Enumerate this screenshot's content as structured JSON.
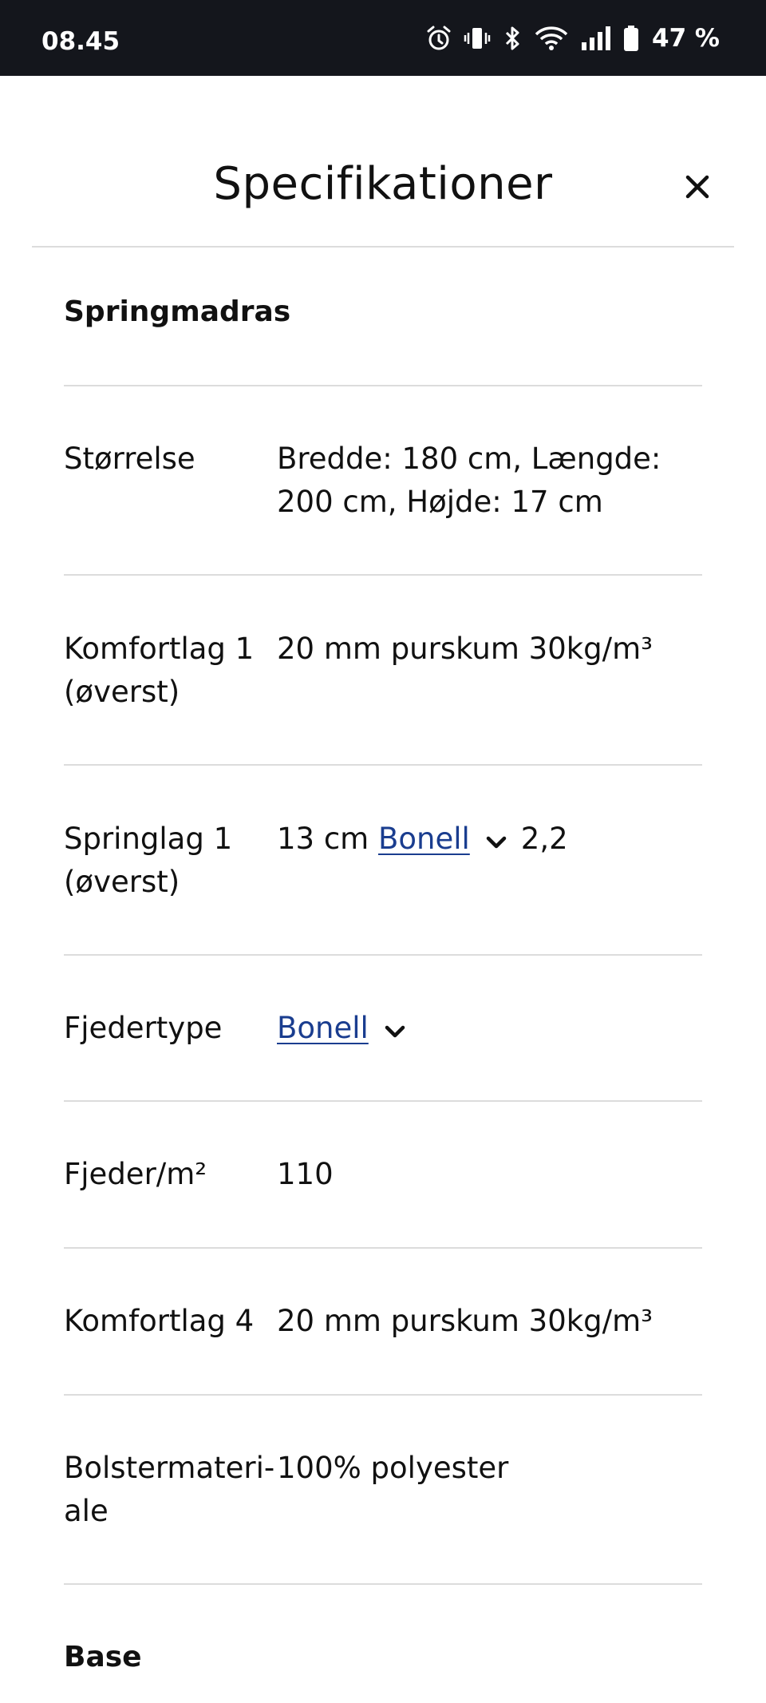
{
  "status_bar": {
    "time": "08.45",
    "battery": "47 %"
  },
  "sheet": {
    "title": "Specifikationer"
  },
  "sections": {
    "springmadras": {
      "title": "Springmadras",
      "rows": [
        {
          "label": "Størrelse",
          "value": "Bredde: 180 cm, Længde: 200 cm, Højde: 17 cm"
        },
        {
          "label": "Komfortlag 1 (øverst)",
          "value": "20 mm purskum 30kg/m³"
        },
        {
          "label": "Springlag 1 (øverst)",
          "value_prefix": "13 cm",
          "value_link": "Bonell",
          "value_suffix": "2,2"
        },
        {
          "label": "Fjedertype",
          "value_link": "Bonell"
        },
        {
          "label": "Fjeder/m²",
          "value": "110"
        },
        {
          "label": "Komfortlag 4",
          "value": "20 mm purskum 30kg/m³"
        },
        {
          "label": "Bolstermateri-ale",
          "label_line1": "Bolstermateri-",
          "label_line2": "ale",
          "value": "100% polyester"
        }
      ]
    },
    "base": {
      "title": "Base"
    }
  }
}
